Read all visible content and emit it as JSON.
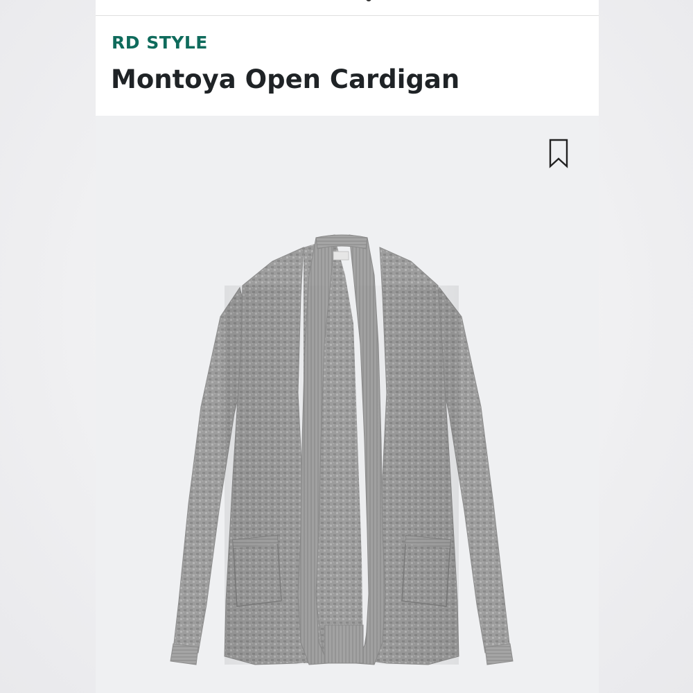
{
  "product": {
    "brand": "RD STYLE",
    "name": "Montoya Open Cardigan"
  },
  "icons": {
    "bookmark": "bookmark-icon"
  },
  "colors": {
    "brand": "#0f6b5c",
    "title": "#1f2326",
    "image_background": "#eff0f2",
    "garment": "#9a9a9a"
  }
}
